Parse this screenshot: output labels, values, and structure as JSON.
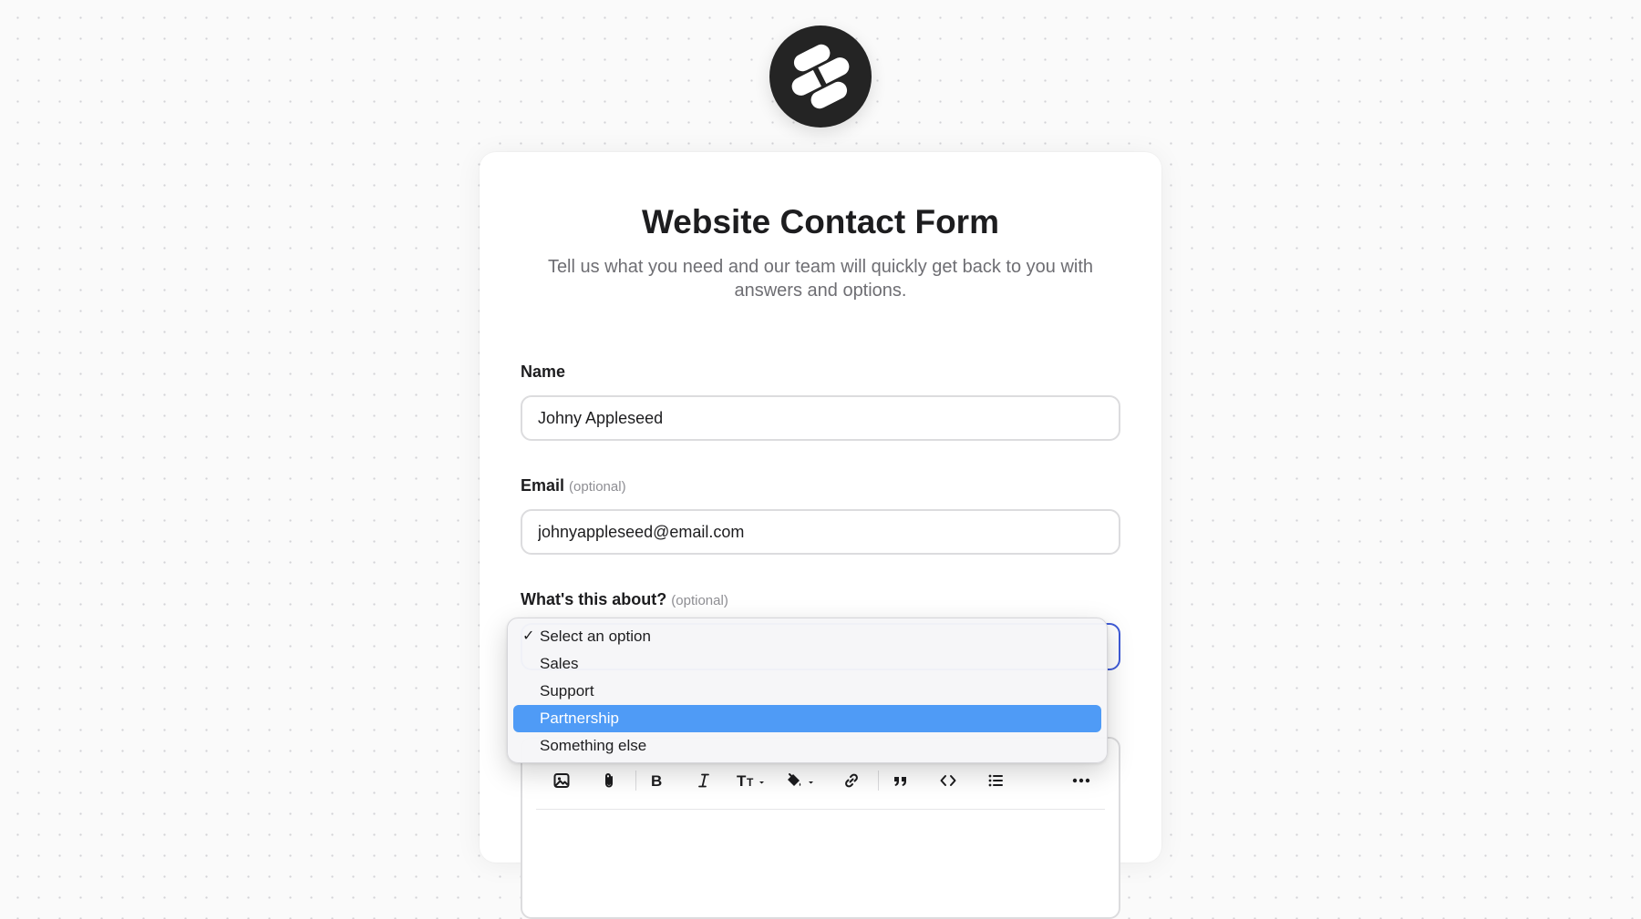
{
  "form": {
    "title": "Website Contact Form",
    "subtitle": "Tell us what you need and our team will quickly get back to you with answers and options.",
    "name": {
      "label": "Name",
      "value": "Johny Appleseed"
    },
    "email": {
      "label": "Email",
      "optional": "(optional)",
      "value": "johnyappleseed@email.com"
    },
    "topic": {
      "label": "What's this about?",
      "optional": "(optional)",
      "options": [
        {
          "label": "Select an option",
          "checked": true,
          "highlighted": false
        },
        {
          "label": "Sales",
          "checked": false,
          "highlighted": false
        },
        {
          "label": "Support",
          "checked": false,
          "highlighted": false
        },
        {
          "label": "Partnership",
          "checked": false,
          "highlighted": true
        },
        {
          "label": "Something else",
          "checked": false,
          "highlighted": false
        }
      ],
      "check_mark": "✓"
    }
  },
  "toolbar": {
    "tools": [
      "image-icon",
      "attachment-icon",
      "bold-icon",
      "italic-icon",
      "text-size-icon",
      "fill-color-icon",
      "link-icon",
      "quote-icon",
      "code-icon",
      "bulleted-list-icon",
      "more-icon"
    ]
  },
  "colors": {
    "accent_focus": "#3f5bd8",
    "highlight": "#4f9bf6",
    "logo_bg": "#242424"
  }
}
